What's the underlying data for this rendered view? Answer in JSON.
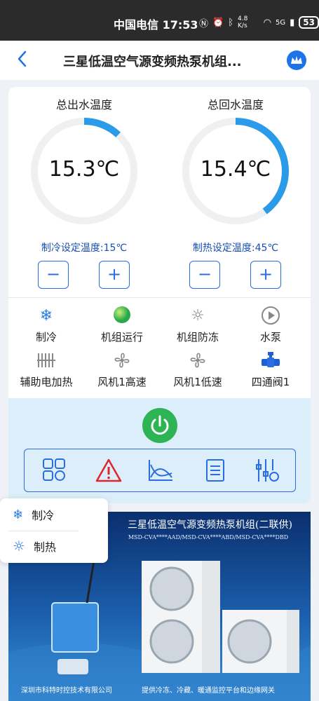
{
  "status_bar": {
    "carrier_time": "中国电信 17:53",
    "network_speed": "4.8 K/s",
    "signal": "5G",
    "battery": "53"
  },
  "header": {
    "back_icon": "chevron-left-icon",
    "title": "三星低温空气源变频热泵机组...",
    "crown_icon": "crown-icon"
  },
  "gauges": [
    {
      "label": "总出水温度",
      "value": "15.3℃",
      "fill": 0.12,
      "color": "#2a9be8"
    },
    {
      "label": "总回水温度",
      "value": "15.4℃",
      "fill": 0.4,
      "color": "#2a9be8"
    }
  ],
  "settings": {
    "cooling": "制冷设定温度:15℃",
    "heating": "制热设定温度:45℃",
    "minus": "−",
    "plus": "+"
  },
  "status_items": [
    {
      "label": "制冷",
      "icon": "snowflake-icon"
    },
    {
      "label": "机组运行",
      "icon": "green-dot-icon"
    },
    {
      "label": "机组防冻",
      "icon": "sun-icon"
    },
    {
      "label": "水泵",
      "icon": "pump-play-icon"
    },
    {
      "label": "辅助电加热",
      "icon": "heater-icon"
    },
    {
      "label": "风机1高速",
      "icon": "fan-icon"
    },
    {
      "label": "风机1低速",
      "icon": "fan-icon"
    },
    {
      "label": "四通阀1",
      "icon": "valve-icon"
    }
  ],
  "toolbar": {
    "items": [
      "grid-icon",
      "alarm-icon",
      "chart-icon",
      "document-icon",
      "settings-sliders-icon"
    ]
  },
  "popup": {
    "items": [
      {
        "label": "制冷",
        "icon": "snowflake-icon"
      },
      {
        "label": "制热",
        "icon": "sun-icon"
      }
    ]
  },
  "banner": {
    "title": "三星低温空气源变频热泵机组(二联供)",
    "models": "MSD-CVA****AAD/MSD-CVA****ABD/MSD-CVA****DBD",
    "footer_left": "深圳市科特时控技术有限公司",
    "footer_right": "提供冷冻、冷藏、暖通监控平台和边缘网关"
  }
}
